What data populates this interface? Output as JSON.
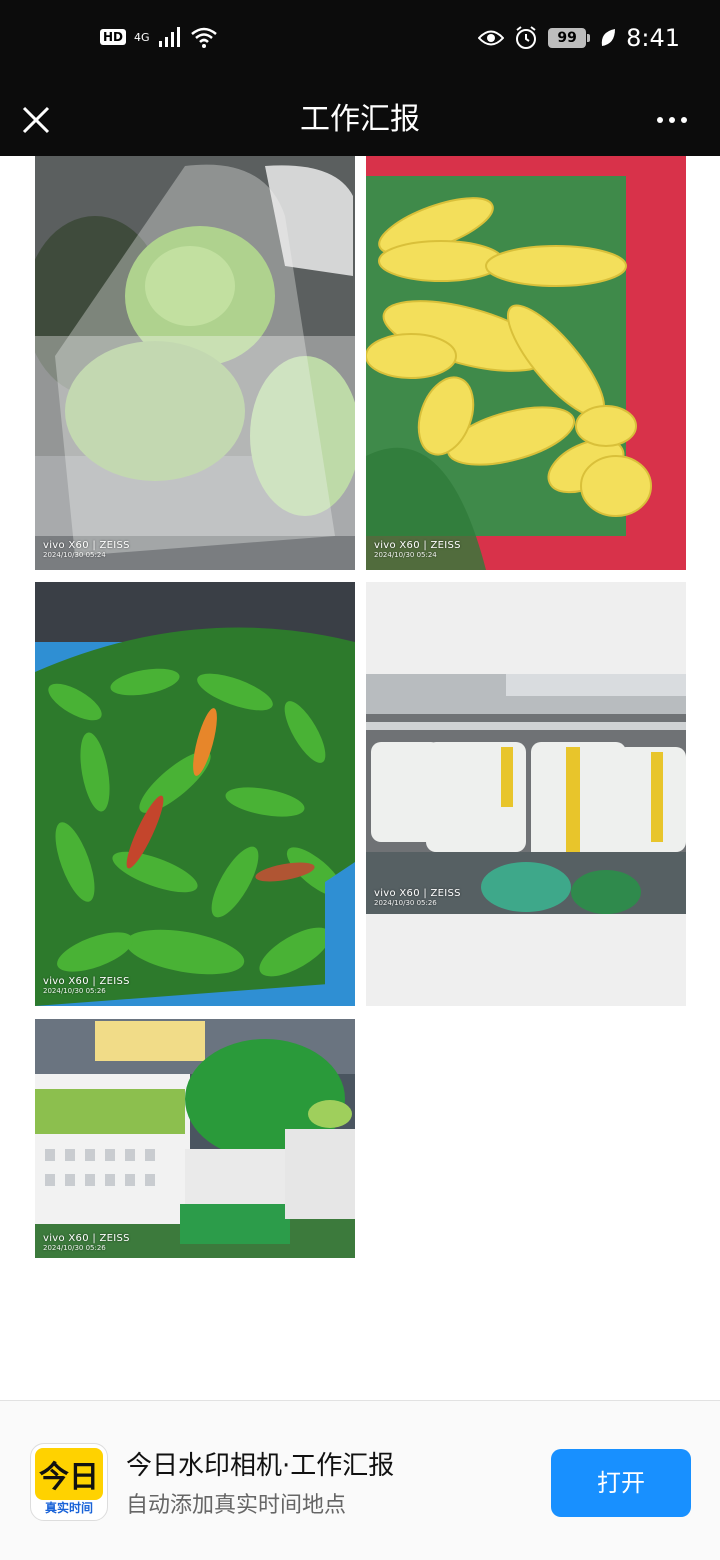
{
  "status_bar": {
    "hd": "HD",
    "network": "4G",
    "battery": "99",
    "time": "8:41"
  },
  "nav": {
    "title": "工作汇报"
  },
  "photos": [
    {
      "subject": "cabbage",
      "watermark_model": "vivo X60 | ZEISS",
      "watermark_date": "2024/10/30 05:24"
    },
    {
      "subject": "corn",
      "watermark_model": "vivo X60 | ZEISS",
      "watermark_date": "2024/10/30 05:24"
    },
    {
      "subject": "green-peppers",
      "watermark_model": "vivo X60 | ZEISS",
      "watermark_date": "2024/10/30 05:26"
    },
    {
      "subject": "fridge-vegetables",
      "watermark_model": "vivo X60 | ZEISS",
      "watermark_date": "2024/10/30 05:26"
    },
    {
      "subject": "vegetable-crates",
      "watermark_model": "vivo X60 | ZEISS",
      "watermark_date": "2024/10/30 05:26"
    }
  ],
  "banner": {
    "icon_top": "今日",
    "icon_bottom": "真实时间",
    "app_name": "今日水印相机·工作汇报",
    "app_desc": "自动添加真实时间地点",
    "open_label": "打开"
  },
  "colors": {
    "topbar": "#0c0c0c",
    "open_button": "#1890ff",
    "icon_yellow": "#ffd200"
  }
}
